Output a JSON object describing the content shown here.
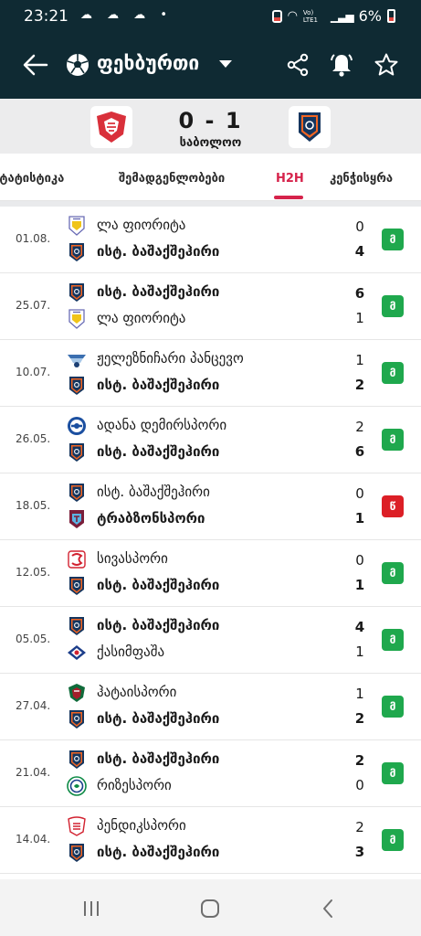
{
  "status_bar": {
    "time": "23:21",
    "left_icons": "☁ ☁ ☁ •",
    "signal_label": "Vo) LTE1",
    "battery": "6%"
  },
  "app_bar": {
    "title": "ფეხბურთი"
  },
  "score_header": {
    "score": "0 - 1",
    "status": "საბოლოო"
  },
  "tabs": [
    {
      "label": "სტატისტიკა",
      "active": false
    },
    {
      "label": "შემადგენლობები",
      "active": false
    },
    {
      "label": "H2H",
      "active": true
    },
    {
      "label": "კენჭისყრა",
      "active": false
    }
  ],
  "matches": [
    {
      "date": "01.08.",
      "home": "ლა ფიორიტა",
      "away": "ისტ. ბაშაქშეჰირი",
      "home_goals": "0",
      "away_goals": "4",
      "result": "მ",
      "home_logo": "la-fiorita",
      "away_logo": "basaksehir"
    },
    {
      "date": "25.07.",
      "home": "ისტ. ბაშაქშეჰირი",
      "away": "ლა ფიორიტა",
      "home_goals": "6",
      "away_goals": "1",
      "result": "მ",
      "home_logo": "basaksehir",
      "away_logo": "la-fiorita"
    },
    {
      "date": "10.07.",
      "home": "ჟელეზნიჩარი პანცევო",
      "away": "ისტ. ბაშაქშეჰირი",
      "home_goals": "1",
      "away_goals": "2",
      "result": "მ",
      "home_logo": "zeleznicar",
      "away_logo": "basaksehir"
    },
    {
      "date": "26.05.",
      "home": "ადანა დემირსპორი",
      "away": "ისტ. ბაშაქშეჰირი",
      "home_goals": "2",
      "away_goals": "6",
      "result": "მ",
      "home_logo": "adana",
      "away_logo": "basaksehir"
    },
    {
      "date": "18.05.",
      "home": "ისტ. ბაშაქშეჰირი",
      "away": "ტრაბზონსპორი",
      "home_goals": "0",
      "away_goals": "1",
      "result": "წ",
      "home_logo": "basaksehir",
      "away_logo": "trabzonspor"
    },
    {
      "date": "12.05.",
      "home": "სივასპორი",
      "away": "ისტ. ბაშაქშეჰირი",
      "home_goals": "0",
      "away_goals": "1",
      "result": "მ",
      "home_logo": "sivasspor",
      "away_logo": "basaksehir"
    },
    {
      "date": "05.05.",
      "home": "ისტ. ბაშაქშეჰირი",
      "away": "ქასიმფაშა",
      "home_goals": "4",
      "away_goals": "1",
      "result": "მ",
      "home_logo": "basaksehir",
      "away_logo": "kasimpasa"
    },
    {
      "date": "27.04.",
      "home": "ჰატაისპორი",
      "away": "ისტ. ბაშაქშეჰირი",
      "home_goals": "1",
      "away_goals": "2",
      "result": "მ",
      "home_logo": "hatayspor",
      "away_logo": "basaksehir"
    },
    {
      "date": "21.04.",
      "home": "ისტ. ბაშაქშეჰირი",
      "away": "რიზესპორი",
      "home_goals": "2",
      "away_goals": "0",
      "result": "მ",
      "home_logo": "basaksehir",
      "away_logo": "rizespor"
    },
    {
      "date": "14.04.",
      "home": "პენდიკსპორი",
      "away": "ისტ. ბაშაქშეჰირი",
      "home_goals": "2",
      "away_goals": "3",
      "result": "მ",
      "home_logo": "pendikspor",
      "away_logo": "basaksehir"
    }
  ],
  "colors": {
    "header_bg": "#0f2a33",
    "accent": "#d6234b",
    "win": "#1fa84d",
    "loss": "#dc1f26"
  }
}
